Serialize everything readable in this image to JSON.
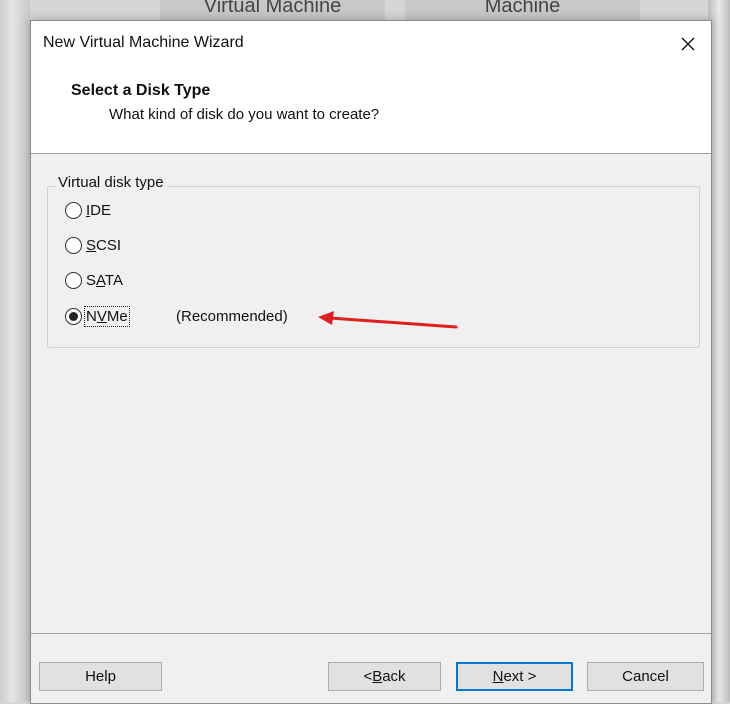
{
  "background": {
    "tab_left": "Virtual Machine",
    "tab_right": "Machine"
  },
  "window": {
    "title": "New Virtual Machine Wizard",
    "close_icon": "close-icon"
  },
  "header": {
    "title": "Select a Disk Type",
    "subtitle": "What kind of disk do you want to create?"
  },
  "disk_type_group": {
    "legend": "Virtual disk type",
    "options": [
      {
        "label": "IDE",
        "access_key": "I",
        "checked": false
      },
      {
        "label": "SCSI",
        "access_key": "S",
        "checked": false
      },
      {
        "label": "SATA",
        "access_key": "A",
        "checked": false
      },
      {
        "label": "NVMe",
        "access_key": "V",
        "checked": true
      }
    ],
    "recommended_note": "(Recommended)"
  },
  "annotation": {
    "arrow_color": "#e02020"
  },
  "buttons": {
    "help": "Help",
    "back_prefix": "< ",
    "back_key": "B",
    "back_rest": "ack",
    "next_key": "N",
    "next_rest": "ext >",
    "cancel": "Cancel"
  },
  "colors": {
    "dialog_bg": "#f0f0f0",
    "header_bg": "#ffffff",
    "focus_border": "#0078d7"
  }
}
